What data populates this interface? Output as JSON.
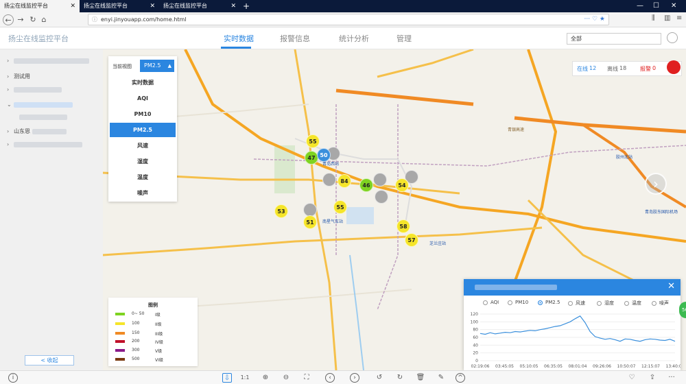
{
  "browser": {
    "tabs": [
      {
        "title": "扬尘在线监控平台"
      },
      {
        "title": "扬尘在线监控平台"
      },
      {
        "title": "扬尘在线监控平台"
      }
    ],
    "url": "enyi.jinyouapp.com/home.html"
  },
  "header": {
    "app_title": "扬尘在线监控平台",
    "nav": [
      "实时数据",
      "报警信息",
      "统计分析",
      "管理"
    ],
    "region": "全部"
  },
  "sidebar": {
    "items": [
      {
        "label": ""
      },
      {
        "label": "测试用"
      },
      {
        "label": ""
      },
      {
        "label": ""
      },
      {
        "label": "山东恩"
      },
      {
        "label": ""
      }
    ],
    "collapse_label": "< 收起"
  },
  "view_panel": {
    "label": "当前视图",
    "selected": "PM2.5",
    "options": [
      "实时数据",
      "AQI",
      "PM10",
      "PM2.5",
      "风速",
      "湿度",
      "温度",
      "噪声"
    ]
  },
  "legend": {
    "title": "图例",
    "rows": [
      {
        "range": "0~ 50",
        "level": "I级",
        "color": "#7ed321"
      },
      {
        "range": "100",
        "level": "II级",
        "color": "#f5e52a"
      },
      {
        "range": "150",
        "level": "III级",
        "color": "#f08a24"
      },
      {
        "range": "200",
        "level": "IV级",
        "color": "#c0102a"
      },
      {
        "range": "300",
        "level": "V级",
        "color": "#8a1a8a"
      },
      {
        "range": "500",
        "level": "VI级",
        "color": "#7a3a10"
      }
    ]
  },
  "status": {
    "online_label": "在线",
    "online_count": "12",
    "offline_label": "离线",
    "offline_count": "18",
    "alarm_label": "报警",
    "alarm_count": "0"
  },
  "map": {
    "markers": [
      {
        "value": "55",
        "color": "#f5e52a"
      },
      {
        "value": "47",
        "color": "#7ed321"
      },
      {
        "value": "50",
        "color": "#3a8fdc"
      },
      {
        "value": "84",
        "color": "#f5e52a"
      },
      {
        "value": "46",
        "color": "#7ed321"
      },
      {
        "value": "54",
        "color": "#f5e52a"
      },
      {
        "value": "53",
        "color": "#f5e52a"
      },
      {
        "value": "55",
        "color": "#f5e52a"
      },
      {
        "value": "51",
        "color": "#f5e52a"
      },
      {
        "value": "58",
        "color": "#f5e52a"
      },
      {
        "value": "57",
        "color": "#f5e52a"
      }
    ],
    "labels": [
      "青岛西站",
      "南星气车站",
      "芝兰庄站",
      "胶州北站",
      "青岛胶东国际机场",
      "青银高速"
    ]
  },
  "popup": {
    "radios": [
      "AQI",
      "PM10",
      "PM2.5",
      "风速",
      "湿度",
      "温度",
      "噪声"
    ],
    "selected": "PM2.5",
    "chart_data": {
      "type": "line",
      "x_ticks": [
        "02:19:06",
        "03:45:05",
        "05:10:05",
        "06:35:05",
        "08:01:04",
        "09:26:06",
        "10:50:07",
        "12:15:07",
        "13:40:06"
      ],
      "ylim": [
        0,
        120
      ],
      "y_ticks": [
        0,
        20,
        40,
        60,
        80,
        100,
        120
      ],
      "series": [
        {
          "values": [
            70,
            68,
            72,
            69,
            71,
            73,
            72,
            75,
            74,
            76,
            78,
            77,
            80,
            82,
            85,
            88,
            90,
            95,
            100,
            108,
            115,
            98,
            75,
            62,
            58,
            55,
            57,
            54,
            50,
            56,
            55,
            52,
            50,
            54,
            56,
            55,
            53,
            52,
            55,
            50
          ],
          "color": "#3a8fdc"
        }
      ]
    }
  },
  "side_badge": "56"
}
